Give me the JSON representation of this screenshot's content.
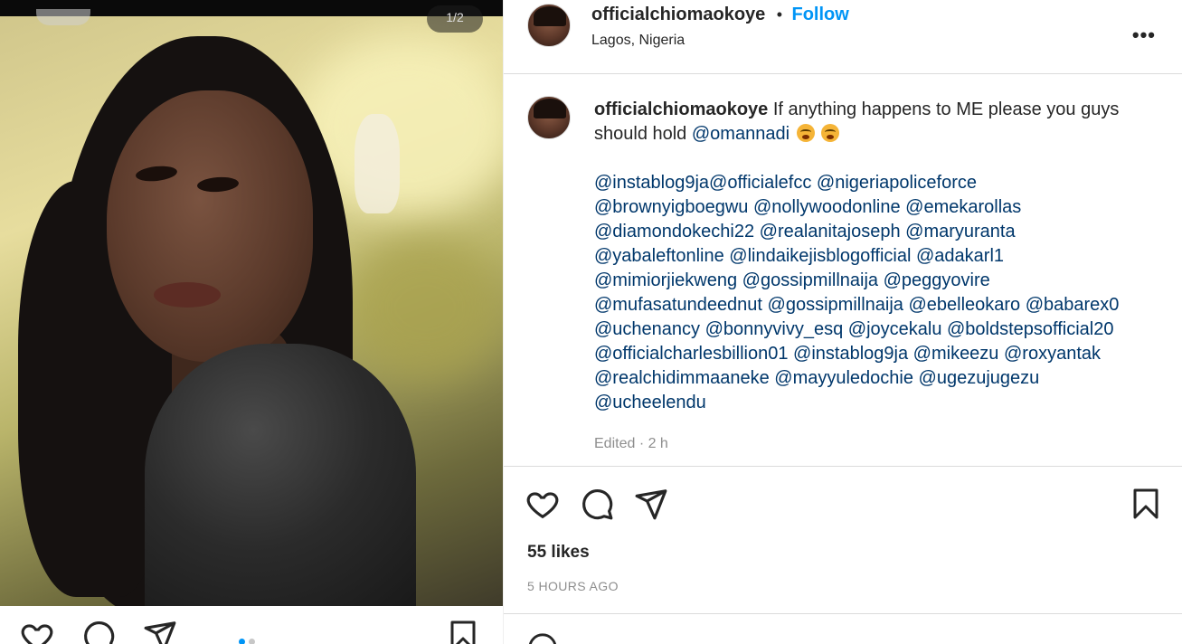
{
  "media": {
    "page_indicator": "1/2",
    "carousel": {
      "count": 2,
      "active": 1,
      "active_color": "#0095f6",
      "inactive_color": "#c7c7c7"
    }
  },
  "post": {
    "username": "officialchiomaokoye",
    "separator": "•",
    "follow_label": "Follow",
    "location": "Lagos, Nigeria",
    "more_label": "•••",
    "caption": {
      "author": "officialchiomaokoye",
      "text": "If anything happens to ME please you guys should hold",
      "mention": "@omannadi",
      "emoji_names": [
        "loudly-crying-face-icon",
        "loudly-crying-face-icon"
      ]
    },
    "tag_lines": [
      "@instablog9ja@officialefcc @nigeriapoliceforce",
      "@brownyigboegwu @nollywoodonline @emekarollas",
      "@diamondokechi22 @realanitajoseph @maryuranta",
      "@yabaleftonline @lindaikejisblogofficial @adakarl1",
      "@mimiorjiekweng @gossipmillnaija @peggyovire",
      "@mufasatundeednut @gossipmillnaija @ebelleokaro @babarex0",
      "@uchenancy @bonnyvivy_esq @joycekalu @boldstepsofficial20",
      "@officialcharlesbillion01 @instablog9ja @mikeezu @roxyantak",
      "@realchidimmaaneke @mayyuledochie @ugezujugezu",
      "@ucheelendu"
    ],
    "edited": "Edited · 2 h",
    "likes": "55 likes",
    "time": "5 HOURS AGO"
  },
  "icons": {
    "like": "heart-icon",
    "comment": "comment-icon",
    "share": "paper-plane-icon",
    "save": "bookmark-icon"
  },
  "colors": {
    "link": "#00376b",
    "accent": "#0095f6",
    "muted": "#8e8e8e",
    "text": "#262626"
  }
}
